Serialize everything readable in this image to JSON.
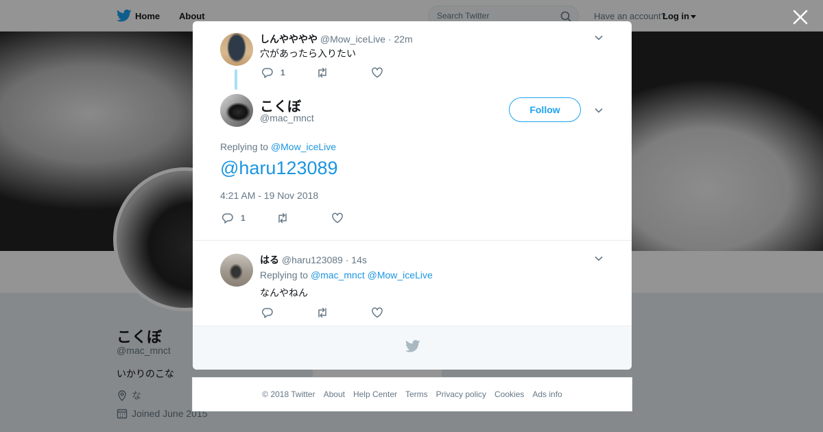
{
  "nav": {
    "home": "Home",
    "about": "About",
    "search_placeholder": "Search Twitter",
    "have_account": "Have an account?",
    "login": "Log in"
  },
  "profile": {
    "name": "こくぼ",
    "handle": "@mac_mnct",
    "bio": "いかりのこな",
    "location": "な",
    "joined": "Joined June 2015"
  },
  "colors": {
    "accent": "#1da1f2",
    "link": "#1b95e0",
    "muted": "#657786",
    "thread_line": "#a7e0f7"
  },
  "modal": {
    "parent_tweet": {
      "name": "しんやややや",
      "handle": "@Mow_iceLive",
      "time": "· 22m",
      "text": "穴があったら入りたい",
      "reply_count": "1"
    },
    "main_tweet": {
      "name": "こくぼ",
      "handle": "@mac_mnct",
      "follow_label": "Follow",
      "replying_prefix": "Replying to",
      "replying_to": "@Mow_iceLive",
      "text": "@haru123089",
      "timestamp": "4:21 AM - 19 Nov 2018",
      "reply_count": "1"
    },
    "reply_tweet": {
      "name": "はる",
      "handle": "@haru123089",
      "time": "· 14s",
      "replying_prefix": "Replying to",
      "replying_to_1": "@mac_mnct",
      "replying_to_2": "@Mow_iceLive",
      "text": "なんやねん"
    }
  },
  "footer": {
    "copyright": "© 2018 Twitter",
    "links": [
      "About",
      "Help Center",
      "Terms",
      "Privacy policy",
      "Cookies",
      "Ads info"
    ]
  }
}
